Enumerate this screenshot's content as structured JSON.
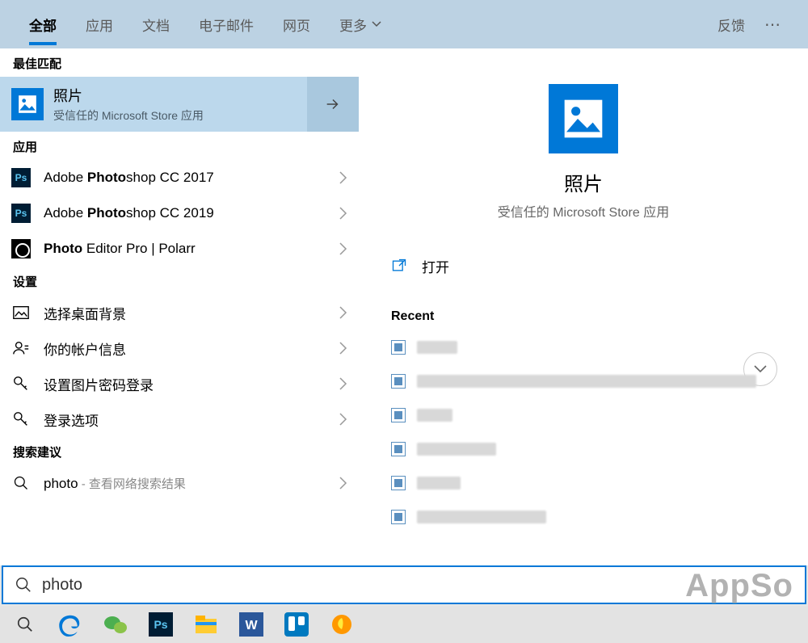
{
  "tabs": {
    "items": [
      "全部",
      "应用",
      "文档",
      "电子邮件",
      "网页",
      "更多"
    ],
    "active_index": 0,
    "feedback": "反馈"
  },
  "left": {
    "best_match_label": "最佳匹配",
    "best_match": {
      "title": "照片",
      "subtitle": "受信任的 Microsoft Store 应用"
    },
    "apps_label": "应用",
    "apps": [
      {
        "pre": "Adobe ",
        "bold": "Photo",
        "post": "shop CC 2017"
      },
      {
        "pre": "Adobe ",
        "bold": "Photo",
        "post": "shop CC 2019"
      },
      {
        "pre": "",
        "bold": "Photo",
        "post": " Editor Pro | Polarr"
      }
    ],
    "settings_label": "设置",
    "settings": [
      "选择桌面背景",
      "你的帐户信息",
      "设置图片密码登录",
      "登录选项"
    ],
    "suggestions_label": "搜索建议",
    "suggestion": {
      "term": "photo",
      "hint": " - 查看网络搜索结果"
    }
  },
  "right": {
    "title": "照片",
    "subtitle": "受信任的 Microsoft Store 应用",
    "open_label": "打开",
    "recent_label": "Recent",
    "recent_widths": [
      50,
      420,
      44,
      98,
      54,
      160
    ]
  },
  "search": {
    "value": "photo"
  },
  "watermark": "AppSo"
}
